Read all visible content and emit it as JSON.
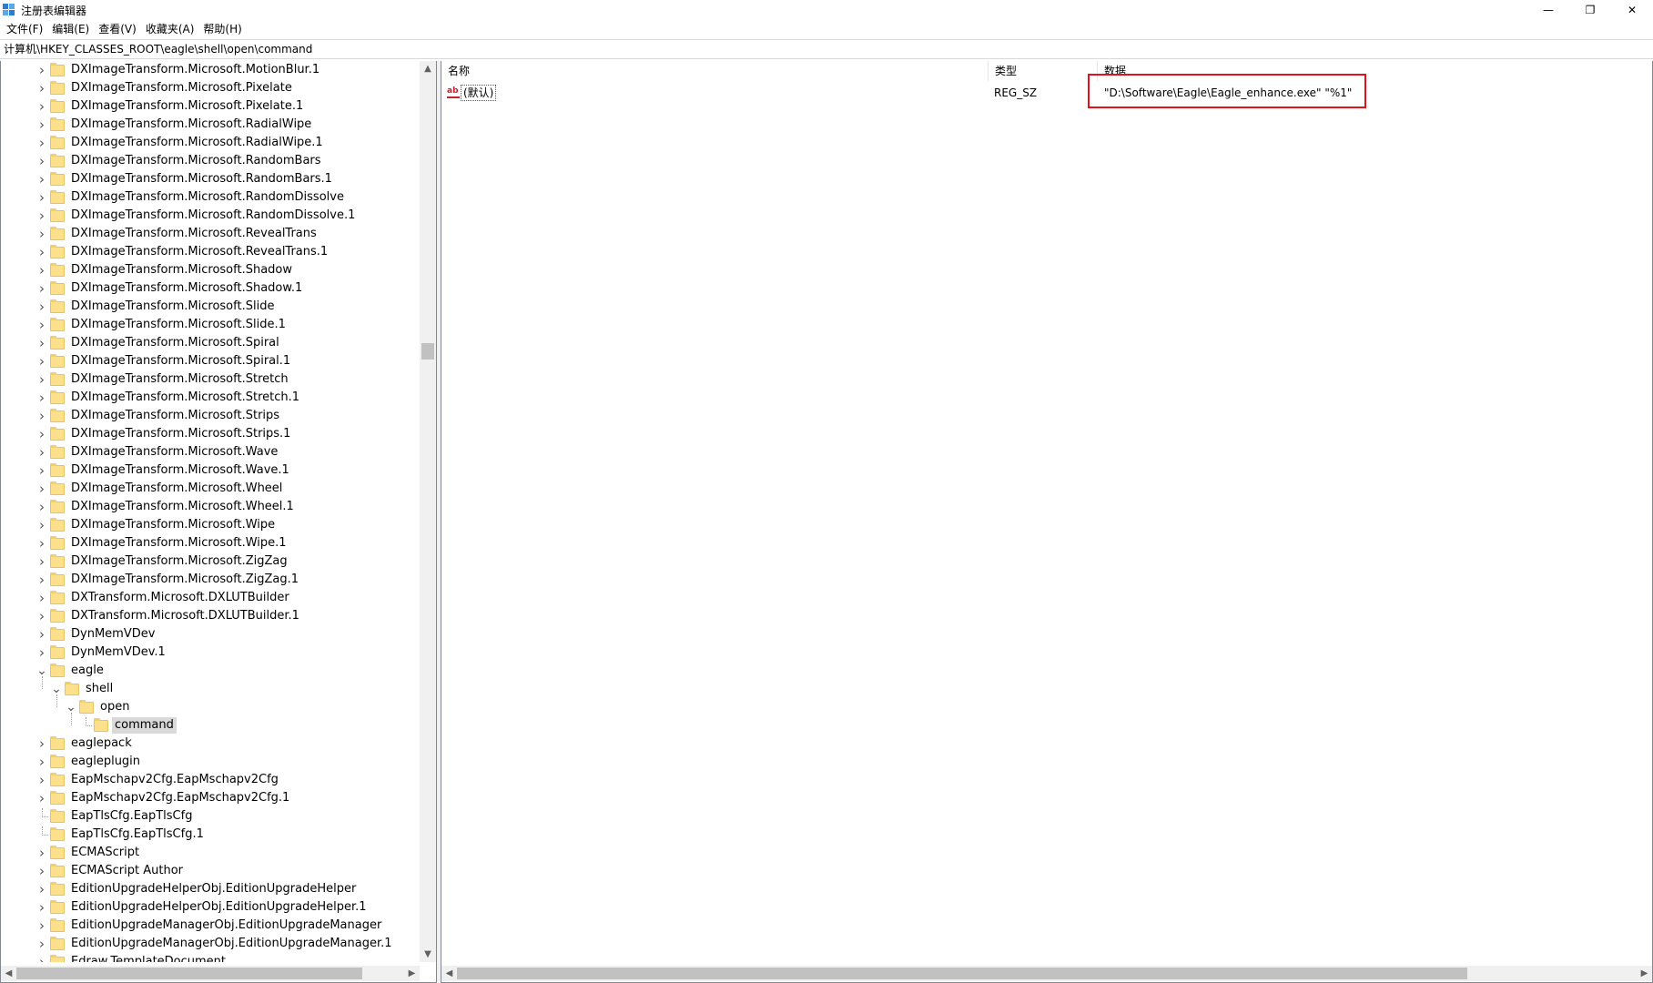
{
  "window": {
    "title": "注册表编辑器",
    "minimize_glyph": "—",
    "restore_glyph": "❐",
    "close_glyph": "✕"
  },
  "menu": [
    "文件(F)",
    "编辑(E)",
    "查看(V)",
    "收藏夹(A)",
    "帮助(H)"
  ],
  "address": "计算机\\HKEY_CLASSES_ROOT\\eagle\\shell\\open\\command",
  "tree": {
    "items": [
      {
        "label": "DXImageTransform.Microsoft.MotionBlur.1",
        "level": 0,
        "expander": "collapsed"
      },
      {
        "label": "DXImageTransform.Microsoft.Pixelate",
        "level": 0,
        "expander": "collapsed"
      },
      {
        "label": "DXImageTransform.Microsoft.Pixelate.1",
        "level": 0,
        "expander": "collapsed"
      },
      {
        "label": "DXImageTransform.Microsoft.RadialWipe",
        "level": 0,
        "expander": "collapsed"
      },
      {
        "label": "DXImageTransform.Microsoft.RadialWipe.1",
        "level": 0,
        "expander": "collapsed"
      },
      {
        "label": "DXImageTransform.Microsoft.RandomBars",
        "level": 0,
        "expander": "collapsed"
      },
      {
        "label": "DXImageTransform.Microsoft.RandomBars.1",
        "level": 0,
        "expander": "collapsed"
      },
      {
        "label": "DXImageTransform.Microsoft.RandomDissolve",
        "level": 0,
        "expander": "collapsed"
      },
      {
        "label": "DXImageTransform.Microsoft.RandomDissolve.1",
        "level": 0,
        "expander": "collapsed"
      },
      {
        "label": "DXImageTransform.Microsoft.RevealTrans",
        "level": 0,
        "expander": "collapsed"
      },
      {
        "label": "DXImageTransform.Microsoft.RevealTrans.1",
        "level": 0,
        "expander": "collapsed"
      },
      {
        "label": "DXImageTransform.Microsoft.Shadow",
        "level": 0,
        "expander": "collapsed"
      },
      {
        "label": "DXImageTransform.Microsoft.Shadow.1",
        "level": 0,
        "expander": "collapsed"
      },
      {
        "label": "DXImageTransform.Microsoft.Slide",
        "level": 0,
        "expander": "collapsed"
      },
      {
        "label": "DXImageTransform.Microsoft.Slide.1",
        "level": 0,
        "expander": "collapsed"
      },
      {
        "label": "DXImageTransform.Microsoft.Spiral",
        "level": 0,
        "expander": "collapsed"
      },
      {
        "label": "DXImageTransform.Microsoft.Spiral.1",
        "level": 0,
        "expander": "collapsed"
      },
      {
        "label": "DXImageTransform.Microsoft.Stretch",
        "level": 0,
        "expander": "collapsed"
      },
      {
        "label": "DXImageTransform.Microsoft.Stretch.1",
        "level": 0,
        "expander": "collapsed"
      },
      {
        "label": "DXImageTransform.Microsoft.Strips",
        "level": 0,
        "expander": "collapsed"
      },
      {
        "label": "DXImageTransform.Microsoft.Strips.1",
        "level": 0,
        "expander": "collapsed"
      },
      {
        "label": "DXImageTransform.Microsoft.Wave",
        "level": 0,
        "expander": "collapsed"
      },
      {
        "label": "DXImageTransform.Microsoft.Wave.1",
        "level": 0,
        "expander": "collapsed"
      },
      {
        "label": "DXImageTransform.Microsoft.Wheel",
        "level": 0,
        "expander": "collapsed"
      },
      {
        "label": "DXImageTransform.Microsoft.Wheel.1",
        "level": 0,
        "expander": "collapsed"
      },
      {
        "label": "DXImageTransform.Microsoft.Wipe",
        "level": 0,
        "expander": "collapsed"
      },
      {
        "label": "DXImageTransform.Microsoft.Wipe.1",
        "level": 0,
        "expander": "collapsed"
      },
      {
        "label": "DXImageTransform.Microsoft.ZigZag",
        "level": 0,
        "expander": "collapsed"
      },
      {
        "label": "DXImageTransform.Microsoft.ZigZag.1",
        "level": 0,
        "expander": "collapsed"
      },
      {
        "label": "DXTransform.Microsoft.DXLUTBuilder",
        "level": 0,
        "expander": "collapsed"
      },
      {
        "label": "DXTransform.Microsoft.DXLUTBuilder.1",
        "level": 0,
        "expander": "collapsed"
      },
      {
        "label": "DynMemVDev",
        "level": 0,
        "expander": "collapsed"
      },
      {
        "label": "DynMemVDev.1",
        "level": 0,
        "expander": "collapsed"
      },
      {
        "label": "eagle",
        "level": 0,
        "expander": "expanded"
      },
      {
        "label": "shell",
        "level": 1,
        "expander": "expanded"
      },
      {
        "label": "open",
        "level": 2,
        "expander": "expanded"
      },
      {
        "label": "command",
        "level": 3,
        "expander": "none",
        "selected": true
      },
      {
        "label": "eaglepack",
        "level": 0,
        "expander": "collapsed"
      },
      {
        "label": "eagleplugin",
        "level": 0,
        "expander": "collapsed"
      },
      {
        "label": "EapMschapv2Cfg.EapMschapv2Cfg",
        "level": 0,
        "expander": "collapsed"
      },
      {
        "label": "EapMschapv2Cfg.EapMschapv2Cfg.1",
        "level": 0,
        "expander": "collapsed"
      },
      {
        "label": "EapTlsCfg.EapTlsCfg",
        "level": 0,
        "expander": "none"
      },
      {
        "label": "EapTlsCfg.EapTlsCfg.1",
        "level": 0,
        "expander": "none"
      },
      {
        "label": "ECMAScript",
        "level": 0,
        "expander": "collapsed"
      },
      {
        "label": "ECMAScript Author",
        "level": 0,
        "expander": "collapsed"
      },
      {
        "label": "EditionUpgradeHelperObj.EditionUpgradeHelper",
        "level": 0,
        "expander": "collapsed"
      },
      {
        "label": "EditionUpgradeHelperObj.EditionUpgradeHelper.1",
        "level": 0,
        "expander": "collapsed"
      },
      {
        "label": "EditionUpgradeManagerObj.EditionUpgradeManager",
        "level": 0,
        "expander": "collapsed"
      },
      {
        "label": "EditionUpgradeManagerObj.EditionUpgradeManager.1",
        "level": 0,
        "expander": "collapsed"
      },
      {
        "label": "Edraw.TemplateDocument",
        "level": 0,
        "expander": "collapsed"
      }
    ]
  },
  "values": {
    "headers": {
      "name": "名称",
      "type": "类型",
      "data": "数据"
    },
    "rows": [
      {
        "name": "(默认)",
        "type": "REG_SZ",
        "data": "\"D:\\Software\\Eagle\\Eagle_enhance.exe\" \"%1\"",
        "icon": "ab-string-icon"
      }
    ]
  },
  "colors": {
    "highlight_border": "#e0121b",
    "selected_row": "#d9d9d9"
  }
}
